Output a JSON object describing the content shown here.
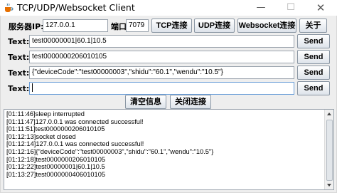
{
  "window": {
    "title": "TCP/UDP/Websocket Client",
    "icon": "coffee-cup-icon",
    "controls": {
      "minimize": "—",
      "maximize": "☐",
      "close": "✕"
    }
  },
  "connection": {
    "server_ip_label": "服务器IP:",
    "server_ip_value": "127.0.0.1",
    "port_label": "端口",
    "port_value": "7079",
    "tcp_button": "TCP连接",
    "udp_button": "UDP连接",
    "websocket_button": "Websocket连接",
    "about_button": "关于"
  },
  "messages": [
    {
      "label": "Text:",
      "value": "test00000001|60.1|10.5",
      "send": "Send"
    },
    {
      "label": "Text:",
      "value": "test0000000206010105",
      "send": "Send"
    },
    {
      "label": "Text:",
      "value": "{\"deviceCode\":\"test00000003\",\"shidu\":\"60.1\",\"wendu\":\"10.5\"}",
      "send": "Send"
    },
    {
      "label": "Text:",
      "value": "",
      "send": "Send"
    }
  ],
  "actions": {
    "clear_button": "清空信息",
    "close_button": "关闭连接"
  },
  "log": [
    "[01:11:46]sleep interrupted",
    "[01:11:47]127.0.0.1 was connected successful!",
    "[01:11:51]test0000000206010105",
    "[01:12:13]socket closed",
    "[01:12:14]127.0.0.1 was connected successful!",
    "[01:12:16]{\"deviceCode\":\"test00000003\",\"shidu\":\"60.1\",\"wendu\":\"10.5\"}",
    "[01:12:18]test0000000206010105",
    "[01:12:22]test00000001|60.1|10.5",
    "[01:13:27]test0000000406010105"
  ]
}
